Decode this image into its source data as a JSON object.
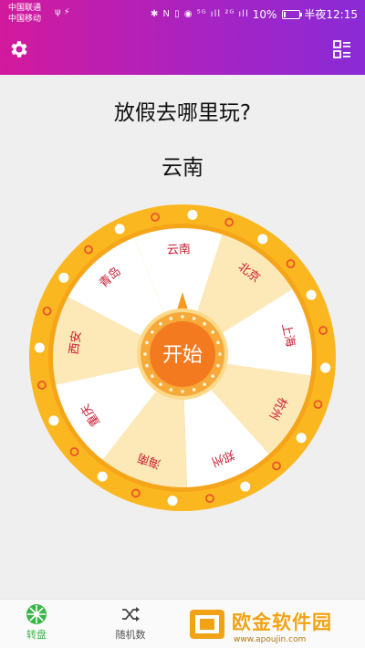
{
  "status_bar": {
    "carrier1": "中国联通",
    "carrier2": "中国移动",
    "left_icons": "ψ ⚡",
    "network_icons": "✱ N ▯ ◉ ⁵ᴳ ıll ²ᴳ ıll",
    "battery_percent": "10%",
    "battery_level": 0.1,
    "time": "半夜12:15"
  },
  "app_bar": {
    "settings_icon": "gear-icon",
    "list_icon": "list-icon",
    "color_start": "#d21a9c",
    "color_end": "#8a2bd6"
  },
  "main": {
    "question": "放假去哪里玩?",
    "result": "云南"
  },
  "wheel": {
    "segments": [
      "云南",
      "北京",
      "上海",
      "杭州",
      "郑州",
      "海南",
      "重庆",
      "西安",
      "青岛"
    ],
    "segment_colors": [
      "#ffffff",
      "#fde9b8"
    ],
    "rim_color": "#fbb720",
    "label_color": "#c81b30",
    "start_button_label": "开始",
    "button_color": "#f47a1f",
    "pointer_color": "#f59a23"
  },
  "tab_bar": {
    "tabs": [
      {
        "label": "转盘",
        "icon": "wheel-icon",
        "active": true
      },
      {
        "label": "随机数",
        "icon": "shuffle-icon",
        "active": false
      }
    ],
    "active_color": "#3bb54a"
  },
  "watermark": {
    "text": "欧金软件园",
    "url": "www.apoujin.com"
  }
}
